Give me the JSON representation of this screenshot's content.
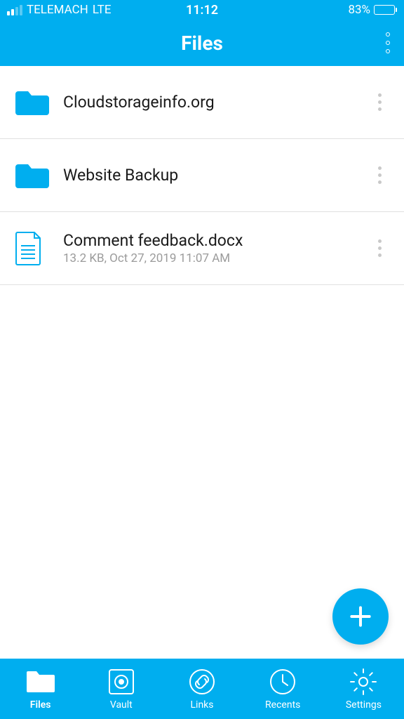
{
  "status": {
    "carrier": "TELEMACH",
    "network": "LTE",
    "time": "11:12",
    "battery": "83%"
  },
  "header": {
    "title": "Files"
  },
  "items": [
    {
      "type": "folder",
      "title": "Cloudstorageinfo.org",
      "sub": ""
    },
    {
      "type": "folder",
      "title": "Website Backup",
      "sub": ""
    },
    {
      "type": "file",
      "title": "Comment feedback.docx",
      "sub": "13.2 KB, Oct 27, 2019 11:07 AM"
    }
  ],
  "tabs": [
    {
      "label": "Files",
      "active": true
    },
    {
      "label": "Vault",
      "active": false
    },
    {
      "label": "Links",
      "active": false
    },
    {
      "label": "Recents",
      "active": false
    },
    {
      "label": "Settings",
      "active": false
    }
  ]
}
